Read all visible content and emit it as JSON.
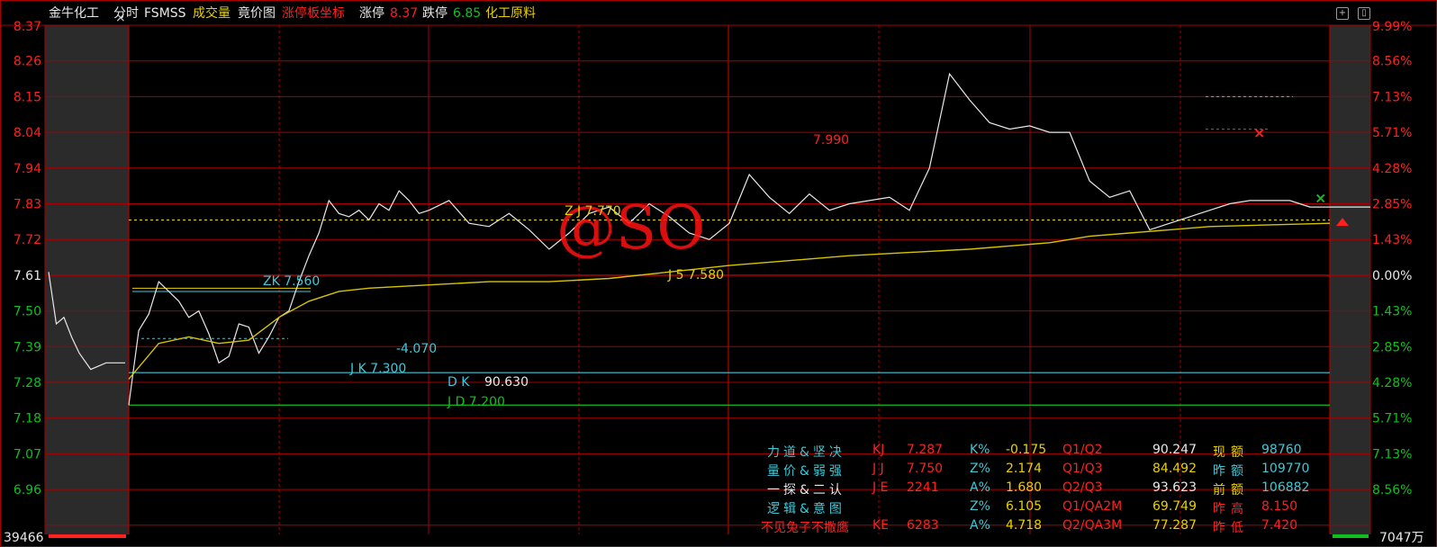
{
  "header": {
    "stock_name": "金牛化工",
    "view_label": "分时",
    "indicator_name": "FSMSS",
    "volume_label": "成交量",
    "auction_label": "竟价图",
    "limit_coord_label": "涨停板坐标",
    "limit_up_label": "涨停",
    "limit_up_value": "8.37",
    "limit_down_label": "跌停",
    "limit_down_value": "6.85",
    "sector_label": "化工原料",
    "close_glyph": "×",
    "icon_names": [
      "add-window-icon",
      "float-window-icon"
    ]
  },
  "colors": {
    "grid": "#a80000",
    "price_line": "#e8e8e8",
    "avg_line": "#d7c400",
    "cyan": "#3fc8d8",
    "green": "#10c020",
    "yellow": "#e8d000",
    "red": "#ff2020",
    "white": "#e8e8e8",
    "gray_panel": "#2b2b2b"
  },
  "overlay": {
    "watermark": "@SO",
    "zj_label": "Z J  7.770",
    "js_label": "J 5    7.580",
    "zk_label": "ZK 7.560",
    "neg_label": "-4.070",
    "jk_label": "J K       7.300",
    "dk_label": "D K",
    "dk_value": "90.630",
    "jd_label": "J D   7.200",
    "high_note": "7.990",
    "volume_left": "39466",
    "volume_right": "7047万"
  },
  "stats": {
    "rows": [
      {
        "name": "力道&坚决",
        "code": "KJ",
        "v1": "7.287",
        "k": "K%",
        "v2": "-0.175",
        "q": "Q1/Q2",
        "v3": "90.247",
        "t": "现额",
        "v4": "98760"
      },
      {
        "name": "量价&弱强",
        "code": "J J",
        "v1": "7.750",
        "k": "Z%",
        "v2": "2.174",
        "q": "Q1/Q3",
        "v3": "84.492",
        "t": "昨额",
        "v4": "109770"
      },
      {
        "name": "一探&二认",
        "code": "J E",
        "v1": "2241",
        "k": "A%",
        "v2": "1.680",
        "q": "Q2/Q3",
        "v3": "93.623",
        "t": "前额",
        "v4": "106882"
      },
      {
        "name": "逻辑&意图",
        "code": "",
        "v1": "",
        "k": "Z%",
        "v2": "6.105",
        "q": "Q1/QA2M",
        "v3": "69.749",
        "t": "昨高",
        "v4": "8.150"
      },
      {
        "name": "不见兔子不撒鹰",
        "code": "KE",
        "v1": "6283",
        "k": "A%",
        "v2": "4.718",
        "q": "Q2/QA3M",
        "v3": "77.287",
        "t": "昨低",
        "v4": "7.420"
      }
    ]
  },
  "chart_data": {
    "type": "line",
    "title": "金牛化工 分时",
    "prev_close": 7.61,
    "ylim": [
      7.07,
      8.37
    ],
    "y_ticks": [
      "8.37",
      "8.26",
      "8.15",
      "8.04",
      "7.94",
      "7.83",
      "7.72",
      "7.61",
      "7.50",
      "7.39",
      "7.28",
      "7.18",
      "7.07",
      "6.96"
    ],
    "y_right_ticks": [
      "9.99%",
      "8.56%",
      "7.13%",
      "5.71%",
      "4.28%",
      "2.85%",
      "1.43%",
      "0.00%",
      "1.43%",
      "2.85%",
      "4.28%",
      "5.71%",
      "7.13%",
      "8.56%"
    ],
    "reference_lines": [
      {
        "name": "ZJ",
        "value": 7.77,
        "style": "dashed",
        "color": "#e8d000"
      },
      {
        "name": "JK",
        "value": 7.3,
        "color": "#3fc8d8"
      },
      {
        "name": "JD",
        "value": 7.2,
        "color": "#10c020"
      }
    ],
    "auction_series": [
      [
        0,
        7.61
      ],
      [
        0.1,
        7.45
      ],
      [
        0.2,
        7.47
      ],
      [
        0.3,
        7.41
      ],
      [
        0.4,
        7.36
      ],
      [
        0.55,
        7.31
      ],
      [
        0.75,
        7.33
      ],
      [
        1.0,
        7.33
      ]
    ],
    "series": [
      {
        "name": "价格",
        "x": [
          0,
          2,
          4,
          6,
          8,
          10,
          12,
          14,
          16,
          18,
          20,
          22,
          24,
          26,
          28,
          30,
          32,
          34,
          36,
          38,
          40,
          42,
          44,
          46,
          48,
          50,
          52,
          54,
          56,
          58,
          60,
          64,
          68,
          72,
          76,
          80,
          84,
          88,
          92,
          96,
          100,
          104,
          108,
          112,
          116,
          120,
          124,
          128,
          132,
          136,
          140,
          144,
          148,
          152,
          156,
          160,
          164,
          168,
          172,
          176,
          180,
          184,
          188,
          192,
          196,
          200,
          204,
          208,
          212,
          216,
          220,
          224,
          228,
          232,
          236,
          240
        ],
        "values": [
          7.2,
          7.43,
          7.48,
          7.58,
          7.55,
          7.52,
          7.47,
          7.49,
          7.42,
          7.33,
          7.35,
          7.45,
          7.44,
          7.36,
          7.41,
          7.47,
          7.49,
          7.58,
          7.66,
          7.73,
          7.83,
          7.79,
          7.78,
          7.8,
          7.77,
          7.82,
          7.8,
          7.86,
          7.83,
          7.79,
          7.8,
          7.83,
          7.76,
          7.75,
          7.79,
          7.74,
          7.68,
          7.73,
          7.79,
          7.81,
          7.76,
          7.82,
          7.78,
          7.73,
          7.71,
          7.76,
          7.91,
          7.84,
          7.79,
          7.85,
          7.8,
          7.82,
          7.83,
          7.84,
          7.8,
          7.93,
          8.22,
          8.14,
          8.07,
          8.05,
          8.06,
          8.04,
          8.04,
          7.89,
          7.84,
          7.86,
          7.74,
          7.76,
          7.78,
          7.8,
          7.82,
          7.83,
          7.83,
          7.83,
          7.81,
          7.81
        ]
      },
      {
        "name": "均价",
        "x": [
          0,
          6,
          12,
          18,
          24,
          30,
          36,
          42,
          48,
          60,
          72,
          84,
          96,
          120,
          144,
          168,
          184,
          192,
          200,
          208,
          216,
          240
        ],
        "values": [
          7.28,
          7.39,
          7.41,
          7.39,
          7.4,
          7.47,
          7.52,
          7.55,
          7.56,
          7.57,
          7.58,
          7.58,
          7.59,
          7.63,
          7.66,
          7.68,
          7.7,
          7.72,
          7.73,
          7.74,
          7.75,
          7.76
        ]
      }
    ]
  }
}
